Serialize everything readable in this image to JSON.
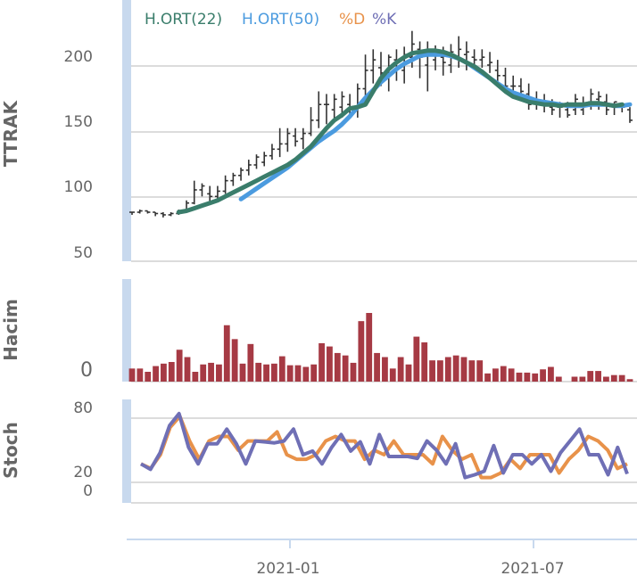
{
  "chart_data": [
    {
      "type": "ohlc",
      "ylabel": "TTRAK",
      "ylim": [
        50,
        235
      ],
      "yticks": [
        50,
        100,
        150,
        200
      ],
      "x_index_range": [
        0,
        64
      ],
      "legend": [
        {
          "name": "H.ORT(22)",
          "color": "#3a7d6b"
        },
        {
          "name": "H.ORT(50)",
          "color": "#4b9bdf"
        },
        {
          "name": "%D",
          "color": "#e8924a"
        },
        {
          "name": "%K",
          "color": "#6f6fb5"
        }
      ],
      "ohlc": [
        [
          88,
          88,
          86,
          88
        ],
        [
          88,
          90,
          87,
          89
        ],
        [
          89,
          89,
          87,
          88
        ],
        [
          88,
          88,
          85,
          87
        ],
        [
          87,
          88,
          84,
          86
        ],
        [
          86,
          88,
          85,
          87
        ],
        [
          87,
          90,
          86,
          89
        ],
        [
          89,
          97,
          88,
          95
        ],
        [
          95,
          112,
          94,
          105
        ],
        [
          105,
          110,
          100,
          108
        ],
        [
          102,
          108,
          96,
          100
        ],
        [
          100,
          108,
          98,
          104
        ],
        [
          104,
          116,
          102,
          112
        ],
        [
          112,
          118,
          108,
          116
        ],
        [
          116,
          122,
          112,
          120
        ],
        [
          120,
          128,
          116,
          124
        ],
        [
          124,
          132,
          121,
          130
        ],
        [
          126,
          134,
          123,
          131
        ],
        [
          131,
          140,
          128,
          136
        ],
        [
          136,
          152,
          130,
          140
        ],
        [
          140,
          152,
          134,
          148
        ],
        [
          146,
          152,
          138,
          142
        ],
        [
          144,
          152,
          136,
          148
        ],
        [
          148,
          168,
          146,
          158
        ],
        [
          158,
          180,
          152,
          170
        ],
        [
          170,
          178,
          155,
          170
        ],
        [
          166,
          178,
          158,
          174
        ],
        [
          168,
          180,
          160,
          176
        ],
        [
          170,
          178,
          160,
          168
        ],
        [
          166,
          186,
          160,
          182
        ],
        [
          182,
          208,
          176,
          196
        ],
        [
          196,
          212,
          186,
          204
        ],
        [
          198,
          210,
          184,
          194
        ],
        [
          190,
          208,
          180,
          206
        ],
        [
          204,
          212,
          188,
          198
        ],
        [
          196,
          214,
          186,
          208
        ],
        [
          206,
          226,
          198,
          216
        ],
        [
          212,
          218,
          190,
          206
        ],
        [
          200,
          218,
          180,
          210
        ],
        [
          204,
          215,
          196,
          210
        ],
        [
          206,
          214,
          192,
          202
        ],
        [
          200,
          216,
          194,
          210
        ],
        [
          206,
          222,
          198,
          212
        ],
        [
          208,
          218,
          196,
          210
        ],
        [
          206,
          212,
          198,
          204
        ],
        [
          204,
          212,
          198,
          206
        ],
        [
          200,
          210,
          194,
          202
        ],
        [
          196,
          204,
          184,
          192
        ],
        [
          192,
          198,
          180,
          184
        ],
        [
          184,
          192,
          176,
          184
        ],
        [
          184,
          190,
          178,
          180
        ],
        [
          178,
          186,
          166,
          170
        ],
        [
          172,
          180,
          166,
          172
        ],
        [
          172,
          178,
          164,
          170
        ],
        [
          168,
          174,
          162,
          166
        ],
        [
          168,
          172,
          160,
          168
        ],
        [
          166,
          172,
          160,
          162
        ],
        [
          166,
          178,
          162,
          174
        ],
        [
          166,
          176,
          162,
          170
        ],
        [
          172,
          182,
          166,
          178
        ],
        [
          174,
          180,
          166,
          176
        ],
        [
          172,
          178,
          162,
          166
        ],
        [
          170,
          172,
          162,
          172
        ],
        [
          168,
          170,
          164,
          168
        ],
        [
          166,
          168,
          156,
          158
        ]
      ],
      "series": [
        {
          "name": "H.ORT(22)",
          "start_index": 6,
          "values": [
            88,
            89,
            91,
            93,
            95,
            97,
            100,
            103,
            106,
            109,
            112,
            115,
            118,
            121,
            124,
            128,
            133,
            138,
            145,
            152,
            158,
            162,
            167,
            168,
            170,
            180,
            190,
            197,
            202,
            206,
            209,
            210,
            211,
            211,
            210,
            208,
            205,
            202,
            199,
            195,
            190,
            185,
            180,
            176,
            174,
            172,
            171,
            170,
            170,
            169,
            170,
            170,
            170,
            171,
            171,
            170,
            169,
            170
          ]
        },
        {
          "name": "H.ORT(50)",
          "start_index": 14,
          "values": [
            98,
            102,
            106,
            110,
            114,
            118,
            122,
            127,
            132,
            137,
            142,
            146,
            150,
            155,
            161,
            168,
            175,
            181,
            187,
            192,
            197,
            201,
            204,
            207,
            208,
            208,
            208,
            207,
            205,
            202,
            198,
            194,
            190,
            186,
            182,
            179,
            177,
            175,
            173,
            172,
            171,
            170,
            169,
            169,
            169,
            170,
            170,
            170,
            169,
            169,
            170
          ]
        }
      ]
    },
    {
      "type": "bar",
      "ylabel": "Hacim",
      "yticks": [
        0
      ],
      "ylim": [
        0,
        12
      ],
      "values": [
        1.6,
        1.6,
        1.2,
        1.9,
        2.2,
        2.4,
        3.9,
        3.0,
        1.2,
        2.1,
        2.3,
        2.1,
        6.9,
        5.2,
        2.2,
        4.6,
        2.3,
        2.1,
        2.2,
        3.1,
        2.0,
        2.0,
        1.8,
        2.1,
        4.7,
        4.3,
        3.5,
        3.2,
        2.3,
        7.4,
        8.4,
        3.5,
        3.0,
        1.6,
        3.0,
        2.1,
        5.5,
        4.8,
        2.6,
        2.6,
        3.0,
        3.2,
        3.0,
        2.6,
        2.6,
        1.0,
        1.6,
        1.9,
        1.6,
        1.1,
        1.1,
        1.0,
        1.5,
        1.8,
        0.6,
        0.0,
        0.6,
        0.6,
        1.3,
        1.3,
        0.6,
        0.8,
        0.8,
        0.3
      ]
    },
    {
      "type": "line",
      "ylabel": "Stoch",
      "yticks": [
        0,
        20,
        80
      ],
      "ylim": [
        0,
        90
      ],
      "series": [
        {
          "name": "%D",
          "values": [
            30,
            25,
            40,
            70,
            82,
            55,
            35,
            55,
            60,
            60,
            45,
            55,
            55,
            55,
            65,
            40,
            35,
            35,
            40,
            55,
            60,
            55,
            55,
            35,
            45,
            40,
            55,
            40,
            40,
            40,
            30,
            60,
            45,
            35,
            40,
            15,
            15,
            20,
            35,
            25,
            40,
            40,
            40,
            20,
            35,
            45,
            60,
            55,
            45,
            25,
            30
          ]
        },
        {
          "name": "%K",
          "values": [
            30,
            24,
            42,
            72,
            85,
            48,
            30,
            52,
            52,
            68,
            52,
            30,
            55,
            54,
            53,
            55,
            68,
            40,
            44,
            30,
            48,
            62,
            44,
            54,
            30,
            62,
            38,
            38,
            38,
            36,
            55,
            45,
            30,
            52,
            15,
            18,
            22,
            50,
            20,
            40,
            40,
            30,
            40,
            22,
            42,
            55,
            68,
            40,
            40,
            18,
            48,
            19
          ]
        }
      ]
    },
    {
      "type": "axis",
      "xtick_labels": [
        "2021-01",
        "2021-07"
      ]
    }
  ]
}
